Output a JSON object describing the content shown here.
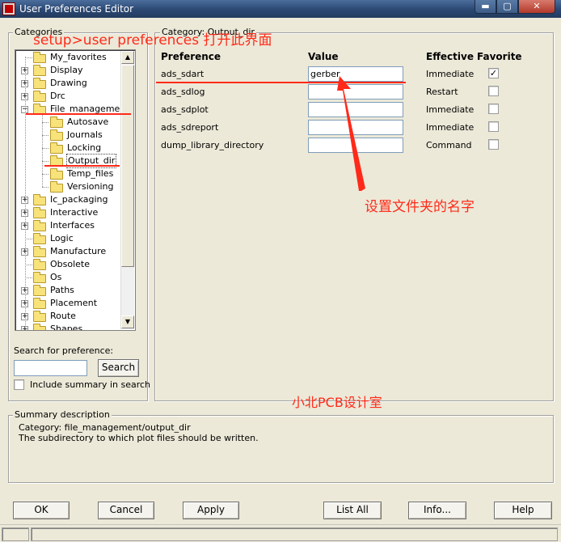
{
  "window": {
    "title": "User Preferences Editor",
    "min_glyph": "▬",
    "max_glyph": "▢",
    "close_glyph": "✕"
  },
  "categories_panel": {
    "label": "Categories",
    "items": [
      {
        "label": "My_favorites",
        "expander": "none",
        "level": 0
      },
      {
        "label": "Display",
        "expander": "+",
        "level": 0
      },
      {
        "label": "Drawing",
        "expander": "+",
        "level": 0
      },
      {
        "label": "Drc",
        "expander": "+",
        "level": 0
      },
      {
        "label": "File_management",
        "expander": "-",
        "level": 0
      },
      {
        "label": "Autosave",
        "expander": "none",
        "level": 1
      },
      {
        "label": "Journals",
        "expander": "none",
        "level": 1
      },
      {
        "label": "Locking",
        "expander": "none",
        "level": 1
      },
      {
        "label": "Output_dir",
        "expander": "none",
        "level": 1,
        "selected": true
      },
      {
        "label": "Temp_files",
        "expander": "none",
        "level": 1
      },
      {
        "label": "Versioning",
        "expander": "none",
        "level": 1
      },
      {
        "label": "Ic_packaging",
        "expander": "+",
        "level": 0
      },
      {
        "label": "Interactive",
        "expander": "+",
        "level": 0
      },
      {
        "label": "Interfaces",
        "expander": "+",
        "level": 0
      },
      {
        "label": "Logic",
        "expander": "none",
        "level": 0
      },
      {
        "label": "Manufacture",
        "expander": "+",
        "level": 0
      },
      {
        "label": "Obsolete",
        "expander": "none",
        "level": 0
      },
      {
        "label": "Os",
        "expander": "none",
        "level": 0
      },
      {
        "label": "Paths",
        "expander": "+",
        "level": 0
      },
      {
        "label": "Placement",
        "expander": "+",
        "level": 0
      },
      {
        "label": "Route",
        "expander": "+",
        "level": 0
      },
      {
        "label": "Shapes",
        "expander": "+",
        "level": 0
      }
    ],
    "scroll_up": "▲",
    "scroll_down": "▼",
    "search_label": "Search for preference:",
    "search_value": "",
    "search_button": "Search",
    "include_summary_label": "Include summary in search",
    "include_summary_checked": false
  },
  "category_panel": {
    "label": "Category:  Output_dir",
    "headers": {
      "preference": "Preference",
      "value": "Value",
      "effective": "Effective",
      "favorite": "Favorite"
    },
    "rows": [
      {
        "preference": "ads_sdart",
        "value": "gerber",
        "effective": "Immediate",
        "favorite": true,
        "favorite_glyph": "✓"
      },
      {
        "preference": "ads_sdlog",
        "value": "",
        "effective": "Restart",
        "favorite": false,
        "favorite_glyph": ""
      },
      {
        "preference": "ads_sdplot",
        "value": "",
        "effective": "Immediate",
        "favorite": false,
        "favorite_glyph": ""
      },
      {
        "preference": "ads_sdreport",
        "value": "",
        "effective": "Immediate",
        "favorite": false,
        "favorite_glyph": ""
      },
      {
        "preference": "dump_library_directory",
        "value": "",
        "effective": "Command",
        "favorite": false,
        "favorite_glyph": ""
      }
    ]
  },
  "summary": {
    "label": "Summary description",
    "line1": "Category: file_management/output_dir",
    "line2": "The subdirectory to which plot files should be written."
  },
  "buttons": {
    "ok": "OK",
    "cancel": "Cancel",
    "apply": "Apply",
    "list_all": "List All",
    "info": "Info...",
    "help": "Help"
  },
  "annotations": {
    "menu_path": "setup>user preferences 打开此界面",
    "folder_name_note": "设置文件夹的名字",
    "watermark": "小北PCB设计室",
    "color": "#ff2a1a"
  }
}
